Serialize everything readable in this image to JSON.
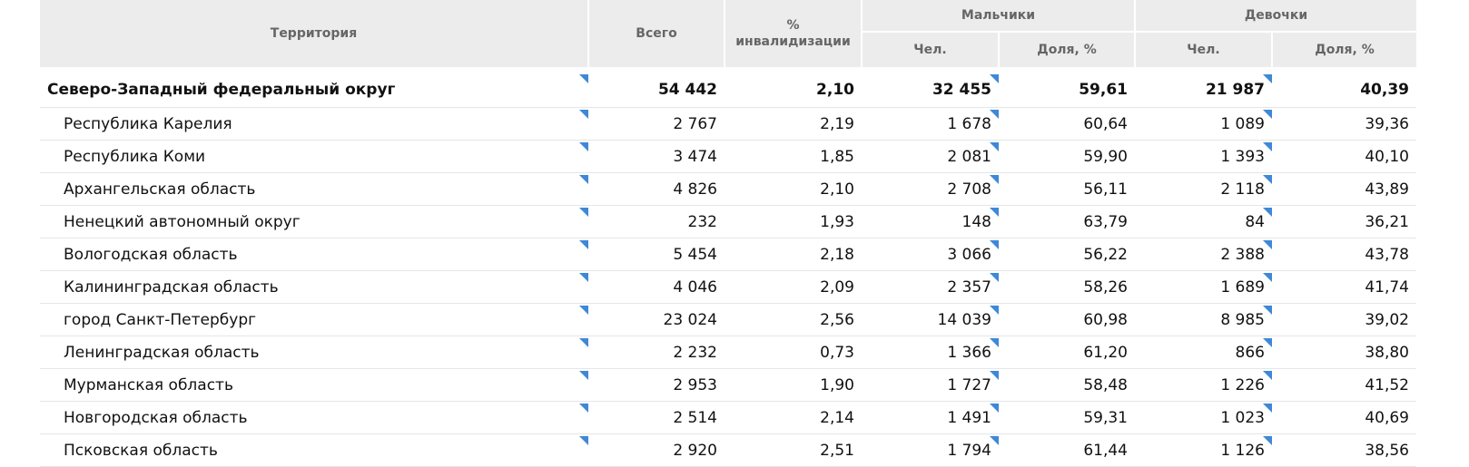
{
  "header": {
    "territory": "Территория",
    "total": "Всего",
    "disability_line1": "%",
    "disability_line2": "инвалидизации",
    "boys": "Мальчики",
    "girls": "Девочки",
    "count": "Чел.",
    "share": "Доля, %"
  },
  "rows": [
    {
      "name": "Северо-Западный федеральный округ",
      "total": "54 442",
      "pct": "2,10",
      "boys_n": "32 455",
      "boys_s": "59,61",
      "girls_n": "21 987",
      "girls_s": "40,39"
    },
    {
      "name": "Республика Карелия",
      "total": "2 767",
      "pct": "2,19",
      "boys_n": "1 678",
      "boys_s": "60,64",
      "girls_n": "1 089",
      "girls_s": "39,36"
    },
    {
      "name": "Республика Коми",
      "total": "3 474",
      "pct": "1,85",
      "boys_n": "2 081",
      "boys_s": "59,90",
      "girls_n": "1 393",
      "girls_s": "40,10"
    },
    {
      "name": "Архангельская область",
      "total": "4 826",
      "pct": "2,10",
      "boys_n": "2 708",
      "boys_s": "56,11",
      "girls_n": "2 118",
      "girls_s": "43,89"
    },
    {
      "name": "Ненецкий автономный округ",
      "total": "232",
      "pct": "1,93",
      "boys_n": "148",
      "boys_s": "63,79",
      "girls_n": "84",
      "girls_s": "36,21"
    },
    {
      "name": "Вологодская область",
      "total": "5 454",
      "pct": "2,18",
      "boys_n": "3 066",
      "boys_s": "56,22",
      "girls_n": "2 388",
      "girls_s": "43,78"
    },
    {
      "name": "Калининградская область",
      "total": "4 046",
      "pct": "2,09",
      "boys_n": "2 357",
      "boys_s": "58,26",
      "girls_n": "1 689",
      "girls_s": "41,74"
    },
    {
      "name": "город Санкт-Петербург",
      "total": "23 024",
      "pct": "2,56",
      "boys_n": "14 039",
      "boys_s": "60,98",
      "girls_n": "8 985",
      "girls_s": "39,02"
    },
    {
      "name": "Ленинградская область",
      "total": "2 232",
      "pct": "0,73",
      "boys_n": "1 366",
      "boys_s": "61,20",
      "girls_n": "866",
      "girls_s": "38,80"
    },
    {
      "name": "Мурманская область",
      "total": "2 953",
      "pct": "1,90",
      "boys_n": "1 727",
      "boys_s": "58,48",
      "girls_n": "1 226",
      "girls_s": "41,52"
    },
    {
      "name": "Новгородская область",
      "total": "2 514",
      "pct": "2,14",
      "boys_n": "1 491",
      "boys_s": "59,31",
      "girls_n": "1 023",
      "girls_s": "40,69"
    },
    {
      "name": "Псковская область",
      "total": "2 920",
      "pct": "2,51",
      "boys_n": "1 794",
      "boys_s": "61,44",
      "girls_n": "1 126",
      "girls_s": "38,56"
    }
  ]
}
